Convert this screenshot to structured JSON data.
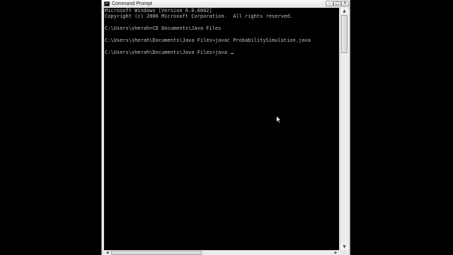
{
  "window": {
    "title": "Command Prompt",
    "buttons": {
      "minimize": "–",
      "maximize": "□",
      "close": "✕"
    }
  },
  "console": {
    "lines": [
      "Microsoft Windows [Version 6.0.6002]",
      "Copyright (c) 2006 Microsoft Corporation.  All rights reserved.",
      "",
      "C:\\Users\\sherah>CD Documents\\Java Files",
      "",
      "C:\\Users\\sherah\\Documents\\Java Files>javac ProbabilitySimulation.java",
      "",
      "C:\\Users\\sherah\\Documents\\Java Files>java "
    ]
  },
  "scrollbars": {
    "vertical": {
      "up": "▲",
      "down": "▼"
    },
    "horizontal": {
      "left": "◀",
      "right": "▶"
    }
  },
  "colors": {
    "console_bg": "#000000",
    "console_text": "#c0c0c0",
    "chrome": "#e7e7e7"
  }
}
